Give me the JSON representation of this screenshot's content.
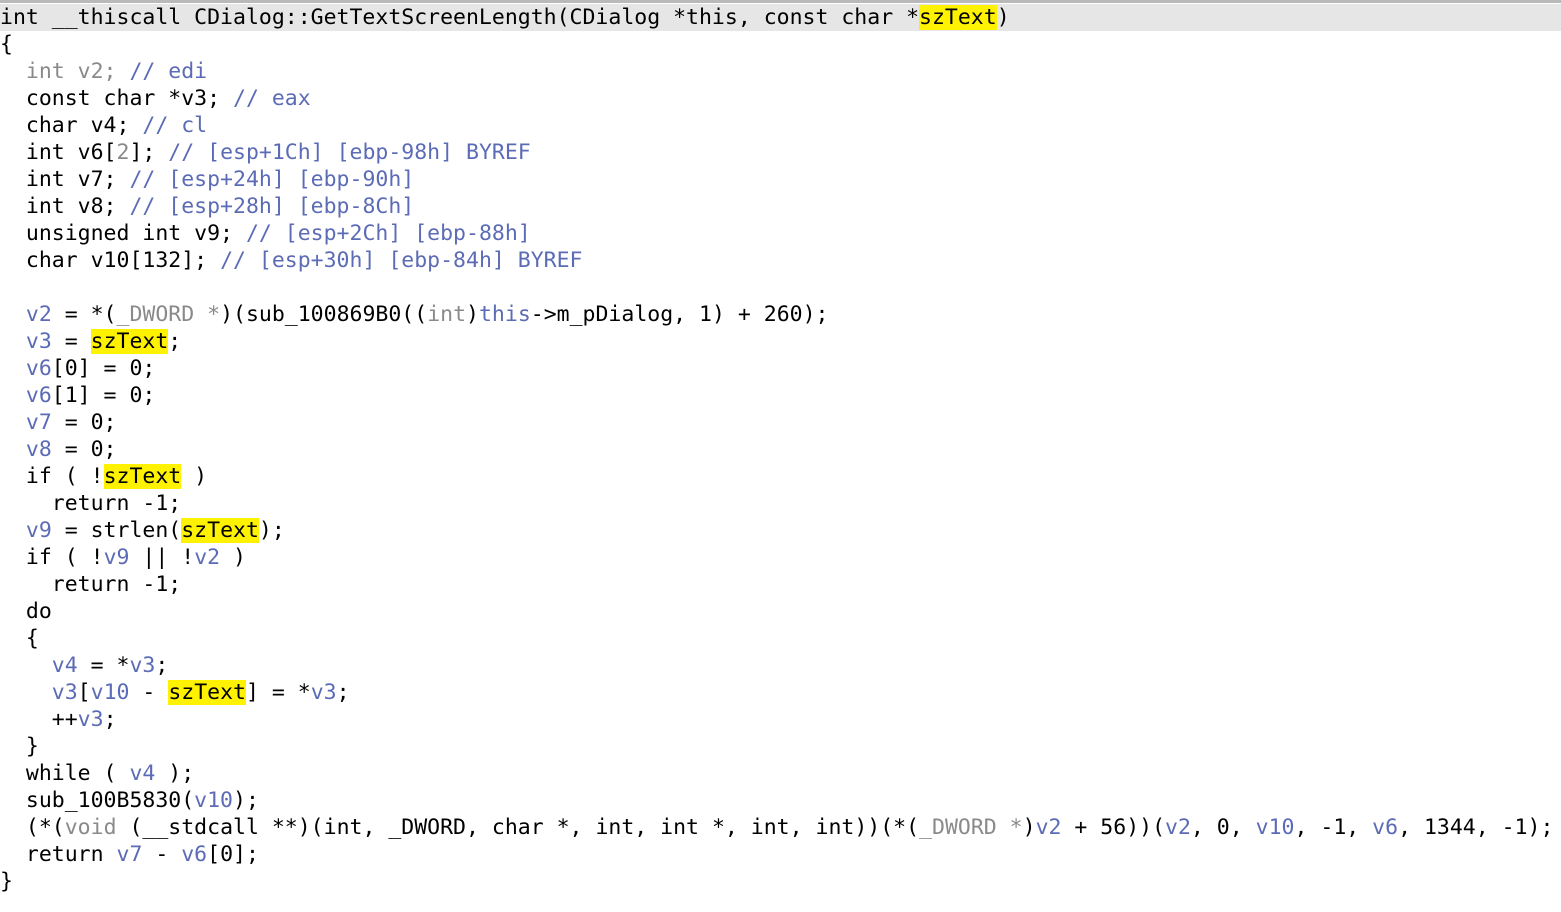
{
  "colors": {
    "default_text": "#000000",
    "variable": "#5c6bb5",
    "gray": "#8a8a8a",
    "highlight": "#fff200",
    "current_line": "#e6e6e6"
  },
  "code_lines": [
    {
      "current": true,
      "tokens": [
        {
          "t": "int __thiscall CDialog::GetTextScreenLength(CDialog *this, const char *",
          "c": "t"
        },
        {
          "t": "szText",
          "c": "hl"
        },
        {
          "t": ")",
          "c": "t"
        }
      ]
    },
    {
      "tokens": [
        {
          "t": "{",
          "c": "t"
        }
      ]
    },
    {
      "tokens": [
        {
          "t": "  int v2; ",
          "c": "g"
        },
        {
          "t": "// edi",
          "c": "v"
        }
      ]
    },
    {
      "tokens": [
        {
          "t": "  const char *v3; ",
          "c": "t"
        },
        {
          "t": "// eax",
          "c": "v"
        }
      ]
    },
    {
      "tokens": [
        {
          "t": "  char v4; ",
          "c": "t"
        },
        {
          "t": "// cl",
          "c": "v"
        }
      ]
    },
    {
      "tokens": [
        {
          "t": "  int v6[",
          "c": "t"
        },
        {
          "t": "2",
          "c": "g"
        },
        {
          "t": "]; ",
          "c": "t"
        },
        {
          "t": "// [esp+1Ch] [ebp-98h] BYREF",
          "c": "v"
        }
      ]
    },
    {
      "tokens": [
        {
          "t": "  int v7; ",
          "c": "t"
        },
        {
          "t": "// [esp+24h] [ebp-90h]",
          "c": "v"
        }
      ]
    },
    {
      "tokens": [
        {
          "t": "  int v8; ",
          "c": "t"
        },
        {
          "t": "// [esp+28h] [ebp-8Ch]",
          "c": "v"
        }
      ]
    },
    {
      "tokens": [
        {
          "t": "  unsigned int v9; ",
          "c": "t"
        },
        {
          "t": "// [esp+2Ch] [ebp-88h]",
          "c": "v"
        }
      ]
    },
    {
      "tokens": [
        {
          "t": "  char v10[132]; ",
          "c": "t"
        },
        {
          "t": "// [esp+30h] [ebp-84h] BYREF",
          "c": "v"
        }
      ]
    },
    {
      "tokens": []
    },
    {
      "tokens": [
        {
          "t": "  ",
          "c": "t"
        },
        {
          "t": "v2",
          "c": "v"
        },
        {
          "t": " = *(",
          "c": "t"
        },
        {
          "t": "_DWORD *",
          "c": "g"
        },
        {
          "t": ")(sub_100869B0((",
          "c": "t"
        },
        {
          "t": "int",
          "c": "g"
        },
        {
          "t": ")",
          "c": "t"
        },
        {
          "t": "this",
          "c": "v"
        },
        {
          "t": "->m_pDialog, 1) + 260);",
          "c": "t"
        }
      ]
    },
    {
      "tokens": [
        {
          "t": "  ",
          "c": "t"
        },
        {
          "t": "v3",
          "c": "v"
        },
        {
          "t": " = ",
          "c": "t"
        },
        {
          "t": "szText",
          "c": "hl"
        },
        {
          "t": ";",
          "c": "t"
        }
      ]
    },
    {
      "tokens": [
        {
          "t": "  ",
          "c": "t"
        },
        {
          "t": "v6",
          "c": "v"
        },
        {
          "t": "[0] = 0;",
          "c": "t"
        }
      ]
    },
    {
      "tokens": [
        {
          "t": "  ",
          "c": "t"
        },
        {
          "t": "v6",
          "c": "v"
        },
        {
          "t": "[1] = 0;",
          "c": "t"
        }
      ]
    },
    {
      "tokens": [
        {
          "t": "  ",
          "c": "t"
        },
        {
          "t": "v7",
          "c": "v"
        },
        {
          "t": " = 0;",
          "c": "t"
        }
      ]
    },
    {
      "tokens": [
        {
          "t": "  ",
          "c": "t"
        },
        {
          "t": "v8",
          "c": "v"
        },
        {
          "t": " = 0;",
          "c": "t"
        }
      ]
    },
    {
      "tokens": [
        {
          "t": "  if ( !",
          "c": "t"
        },
        {
          "t": "szText",
          "c": "hl"
        },
        {
          "t": " )",
          "c": "t"
        }
      ]
    },
    {
      "tokens": [
        {
          "t": "    return -1;",
          "c": "t"
        }
      ]
    },
    {
      "tokens": [
        {
          "t": "  ",
          "c": "t"
        },
        {
          "t": "v9",
          "c": "v"
        },
        {
          "t": " = strlen(",
          "c": "t"
        },
        {
          "t": "szText",
          "c": "hl"
        },
        {
          "t": ");",
          "c": "t"
        }
      ]
    },
    {
      "tokens": [
        {
          "t": "  if ( !",
          "c": "t"
        },
        {
          "t": "v9",
          "c": "v"
        },
        {
          "t": " || !",
          "c": "t"
        },
        {
          "t": "v2",
          "c": "v"
        },
        {
          "t": " )",
          "c": "t"
        }
      ]
    },
    {
      "tokens": [
        {
          "t": "    return -1;",
          "c": "t"
        }
      ]
    },
    {
      "tokens": [
        {
          "t": "  do",
          "c": "t"
        }
      ]
    },
    {
      "tokens": [
        {
          "t": "  {",
          "c": "t"
        }
      ]
    },
    {
      "tokens": [
        {
          "t": "    ",
          "c": "t"
        },
        {
          "t": "v4",
          "c": "v"
        },
        {
          "t": " = *",
          "c": "t"
        },
        {
          "t": "v3",
          "c": "v"
        },
        {
          "t": ";",
          "c": "t"
        }
      ]
    },
    {
      "tokens": [
        {
          "t": "    ",
          "c": "t"
        },
        {
          "t": "v3",
          "c": "v"
        },
        {
          "t": "[",
          "c": "t"
        },
        {
          "t": "v10",
          "c": "v"
        },
        {
          "t": " - ",
          "c": "t"
        },
        {
          "t": "szText",
          "c": "hl"
        },
        {
          "t": "] = *",
          "c": "t"
        },
        {
          "t": "v3",
          "c": "v"
        },
        {
          "t": ";",
          "c": "t"
        }
      ]
    },
    {
      "tokens": [
        {
          "t": "    ++",
          "c": "t"
        },
        {
          "t": "v3",
          "c": "v"
        },
        {
          "t": ";",
          "c": "t"
        }
      ]
    },
    {
      "tokens": [
        {
          "t": "  }",
          "c": "t"
        }
      ]
    },
    {
      "tokens": [
        {
          "t": "  while ( ",
          "c": "t"
        },
        {
          "t": "v4",
          "c": "v"
        },
        {
          "t": " );",
          "c": "t"
        }
      ]
    },
    {
      "tokens": [
        {
          "t": "  sub_100B5830(",
          "c": "t"
        },
        {
          "t": "v10",
          "c": "v"
        },
        {
          "t": ");",
          "c": "t"
        }
      ]
    },
    {
      "tokens": [
        {
          "t": "  (*(",
          "c": "t"
        },
        {
          "t": "void",
          "c": "g"
        },
        {
          "t": " (__stdcall **)(int, _DWORD, char *, int, int *, int, int))(*(",
          "c": "t"
        },
        {
          "t": "_DWORD *",
          "c": "g"
        },
        {
          "t": ")",
          "c": "t"
        },
        {
          "t": "v2",
          "c": "v"
        },
        {
          "t": " + 56))(",
          "c": "t"
        },
        {
          "t": "v2",
          "c": "v"
        },
        {
          "t": ", 0, ",
          "c": "t"
        },
        {
          "t": "v10",
          "c": "v"
        },
        {
          "t": ", -1, ",
          "c": "t"
        },
        {
          "t": "v6",
          "c": "v"
        },
        {
          "t": ", 1344, -1);",
          "c": "t"
        }
      ]
    },
    {
      "tokens": [
        {
          "t": "  return ",
          "c": "t"
        },
        {
          "t": "v7",
          "c": "v"
        },
        {
          "t": " - ",
          "c": "t"
        },
        {
          "t": "v6",
          "c": "v"
        },
        {
          "t": "[0];",
          "c": "t"
        }
      ]
    },
    {
      "tokens": [
        {
          "t": "}",
          "c": "t"
        }
      ]
    }
  ]
}
